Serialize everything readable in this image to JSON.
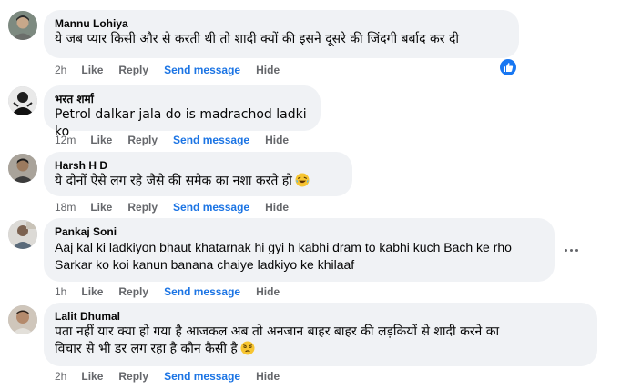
{
  "comments": [
    {
      "author": "Mannu Lohiya",
      "text": "ये जब प्यार किसी और से करती थी तो शादी क्यों की इसने दूसरे की जिंदगी बर्बाद कर दी",
      "time": "2h",
      "like": "Like",
      "reply": "Reply",
      "send": "Send message",
      "hide": "Hide",
      "reaction_icon": "like-icon"
    },
    {
      "author": "भरत शर्मा",
      "text": "Petrol dalkar jala do is madrachod ladki ko",
      "time": "12m",
      "like": "Like",
      "reply": "Reply",
      "send": "Send message",
      "hide": "Hide"
    },
    {
      "author": "Harsh H D",
      "text": "ये दोनों ऐसे लग रहे जैसे की समेक का नशा करते हो",
      "emoji": "laughing-emoji",
      "time": "18m",
      "like": "Like",
      "reply": "Reply",
      "send": "Send message",
      "hide": "Hide"
    },
    {
      "author": "Pankaj Soni",
      "text_lines": [
        "Aaj kal ki ladkiyon bhaut khatarnak hi gyi h kabhi dram to kabhi kuch Bach ke rho",
        "Sarkar ko koi kanun banana chaiye ladkiyo ke khilaaf"
      ],
      "time": "1h",
      "like": "Like",
      "reply": "Reply",
      "send": "Send message",
      "hide": "Hide",
      "more_icon": "more-options-icon"
    },
    {
      "author": "Lalit Dhumal",
      "text_lines": [
        "पता नहीं यार क्या हो गया है आजकल अब तो अनजान बाहर बाहर की लड़कियों से शादी करने का",
        "विचार से भी डर लग रहा है कौन कैसी है"
      ],
      "emoji": "pensive-emoji",
      "time": "2h",
      "like": "Like",
      "reply": "Reply",
      "send": "Send message",
      "hide": "Hide"
    }
  ],
  "colors": {
    "bubble": "#f0f2f5",
    "meta": "#65676b",
    "link": "#1b74e4",
    "like_badge": "#1877f2"
  }
}
